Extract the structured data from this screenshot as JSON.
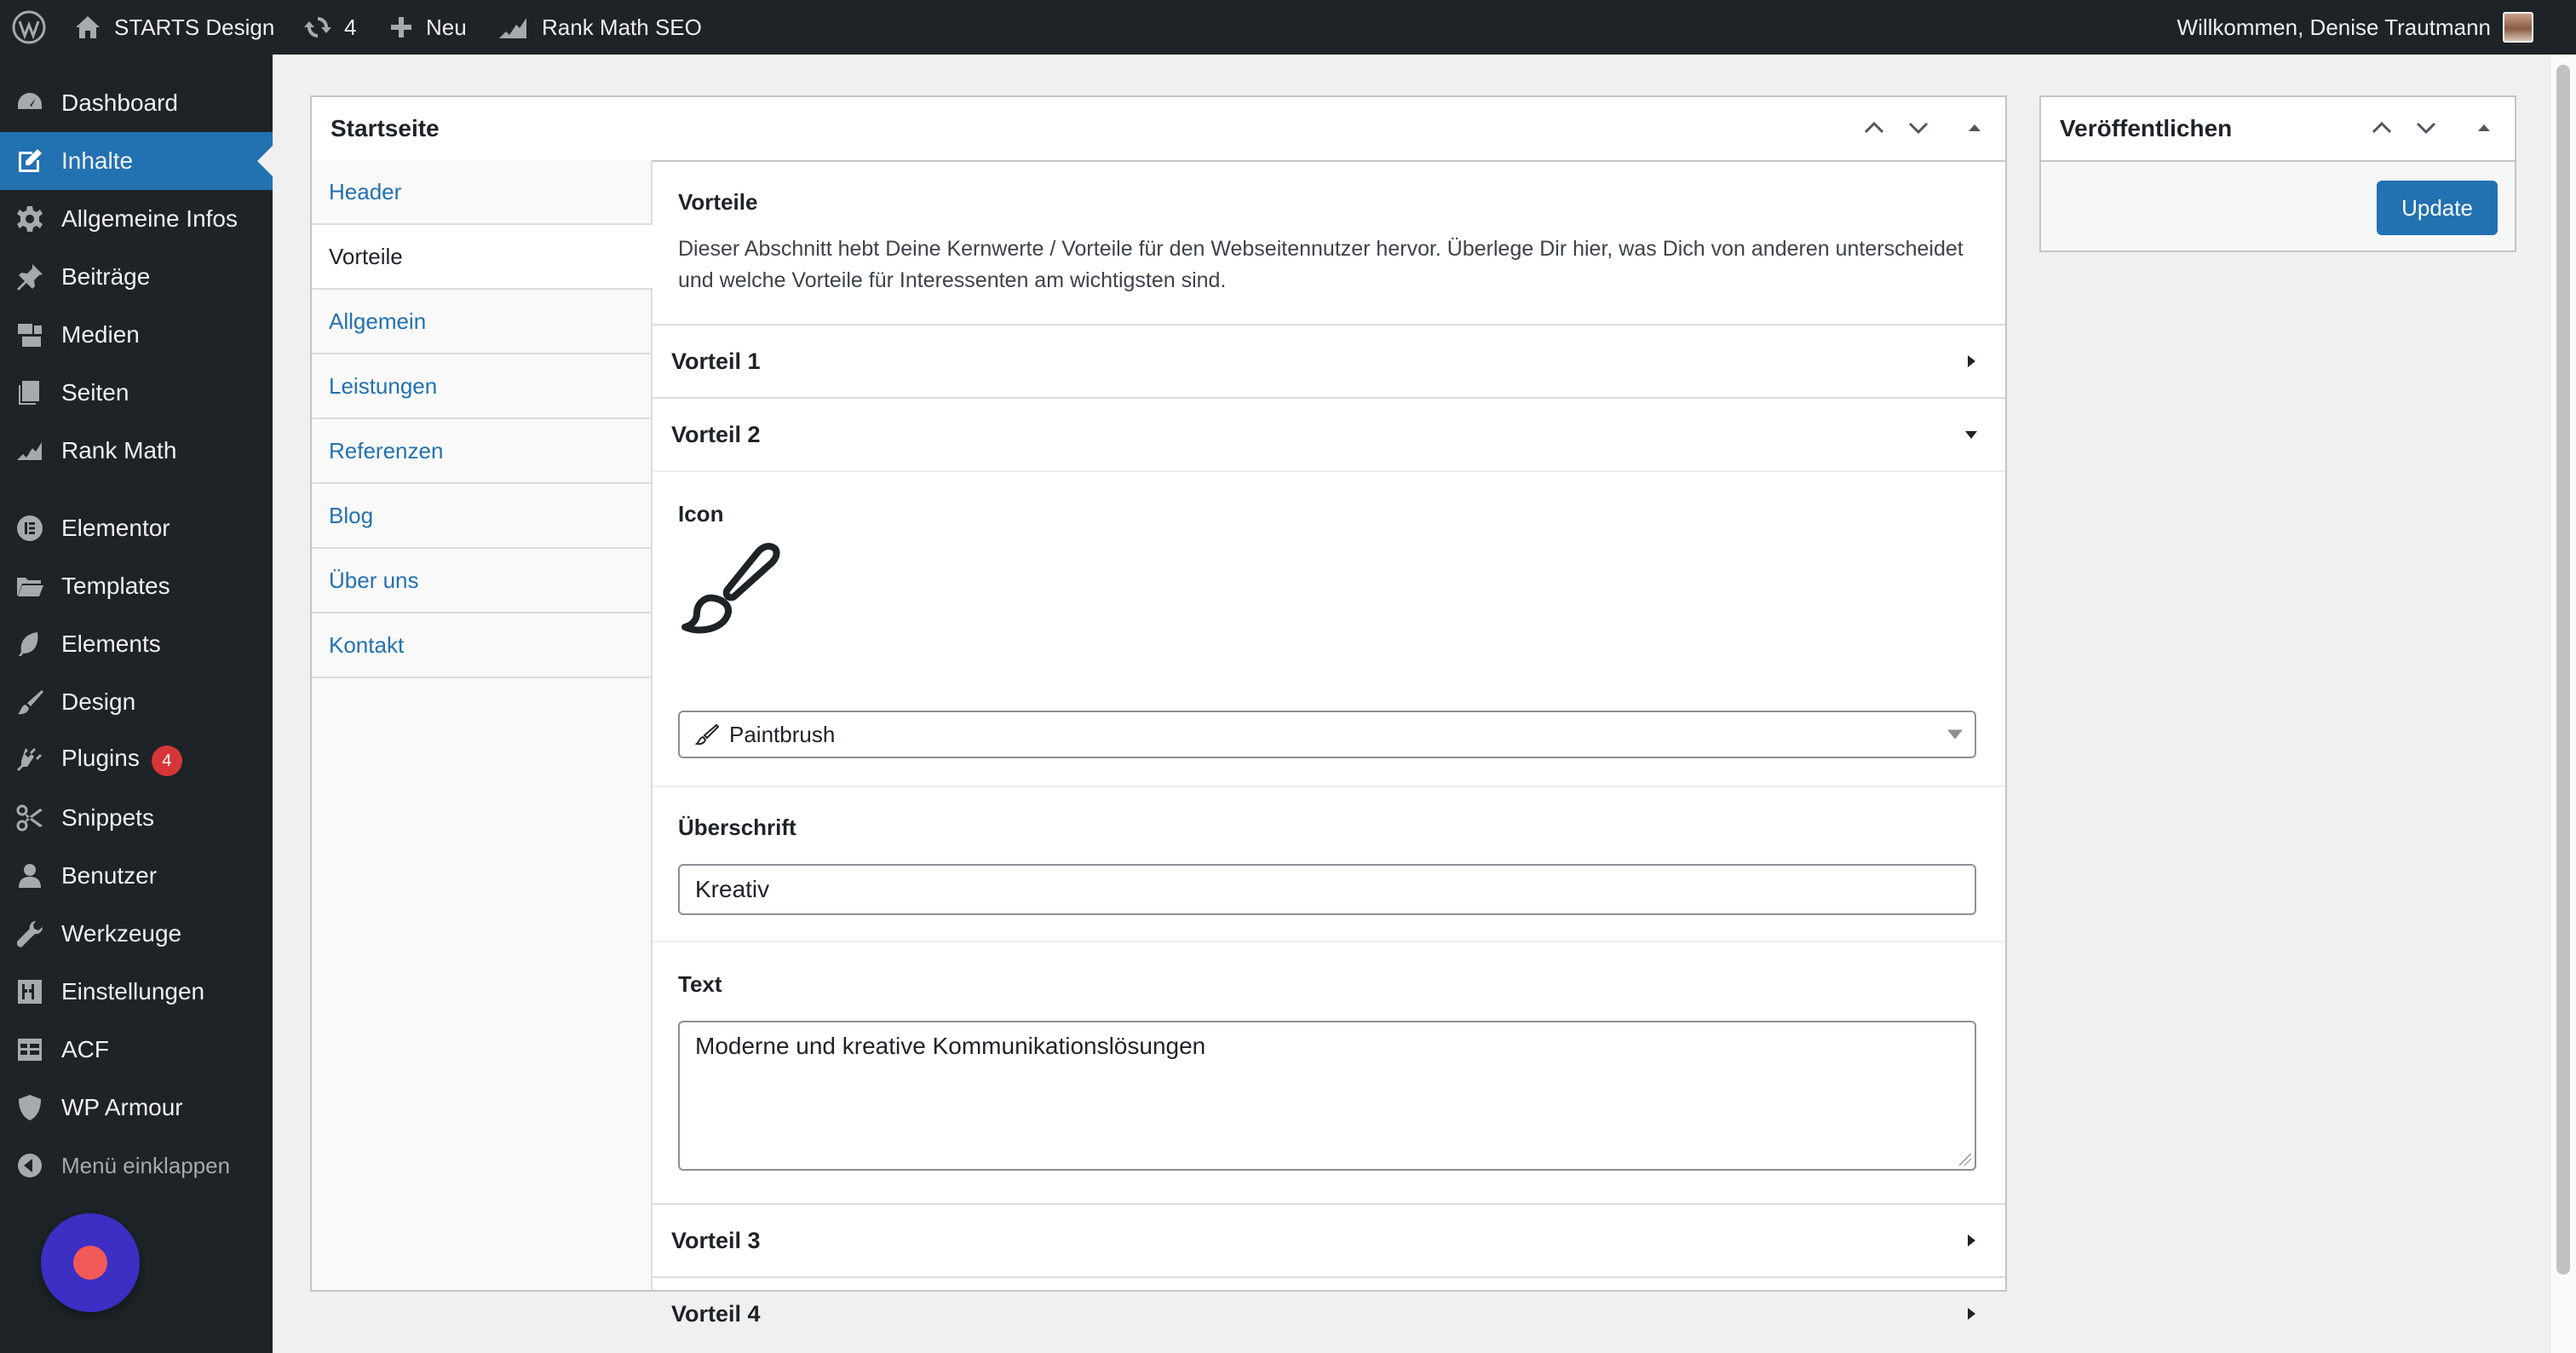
{
  "adminbar": {
    "site_name": "STARTS Design",
    "updates_count": "4",
    "new_label": "Neu",
    "seo_label": "Rank Math SEO",
    "greeting": "Willkommen, Denise Trautmann"
  },
  "sidebar": {
    "items": [
      {
        "label": "Dashboard",
        "icon": "dashboard-icon"
      },
      {
        "label": "Inhalte",
        "icon": "edit-page-icon"
      },
      {
        "label": "Allgemeine Infos",
        "icon": "gear-icon"
      },
      {
        "label": "Beiträge",
        "icon": "pushpin-icon"
      },
      {
        "label": "Medien",
        "icon": "media-icon"
      },
      {
        "label": "Seiten",
        "icon": "pages-icon"
      },
      {
        "label": "Rank Math",
        "icon": "rankmath-icon"
      },
      {
        "label": "Elementor",
        "icon": "elementor-icon"
      },
      {
        "label": "Templates",
        "icon": "folder-icon"
      },
      {
        "label": "Elements",
        "icon": "leaf-icon"
      },
      {
        "label": "Design",
        "icon": "paintbrush-icon"
      },
      {
        "label": "Plugins",
        "icon": "plugin-icon",
        "badge": "4"
      },
      {
        "label": "Snippets",
        "icon": "scissors-icon"
      },
      {
        "label": "Benutzer",
        "icon": "user-icon"
      },
      {
        "label": "Werkzeuge",
        "icon": "wrench-icon"
      },
      {
        "label": "Einstellungen",
        "icon": "settings-sliders-icon"
      },
      {
        "label": "ACF",
        "icon": "grid-icon"
      },
      {
        "label": "WP Armour",
        "icon": "shield-icon"
      }
    ],
    "collapse_label": "Menü einklappen"
  },
  "main": {
    "title": "Startseite",
    "tabs": [
      "Header",
      "Vorteile",
      "Allgemein",
      "Leistungen",
      "Referenzen",
      "Blog",
      "Über uns",
      "Kontakt"
    ],
    "active_tab": "Vorteile",
    "section_title": "Vorteile",
    "section_description": "Dieser Abschnitt hebt Deine Kernwerte / Vorteile für den Webseitennutzer hervor. Überlege Dir hier, was Dich von anderen unterscheidet und welche Vorteile für Interessenten am wichtigsten sind.",
    "accordions": {
      "vorteil1": "Vorteil 1",
      "vorteil2": "Vorteil 2",
      "vorteil3": "Vorteil 3",
      "vorteil4": "Vorteil 4"
    },
    "fields": {
      "icon_label": "Icon",
      "icon_select_value": "Paintbrush",
      "heading_label": "Überschrift",
      "heading_value": "Kreativ",
      "text_label": "Text",
      "text_value": "Moderne und kreative Kommunikationslösungen"
    }
  },
  "publish": {
    "title": "Veröffentlichen",
    "update_label": "Update"
  },
  "colors": {
    "adminbar_bg": "#1d2327",
    "accent": "#2271b1",
    "badge": "#d63638"
  }
}
